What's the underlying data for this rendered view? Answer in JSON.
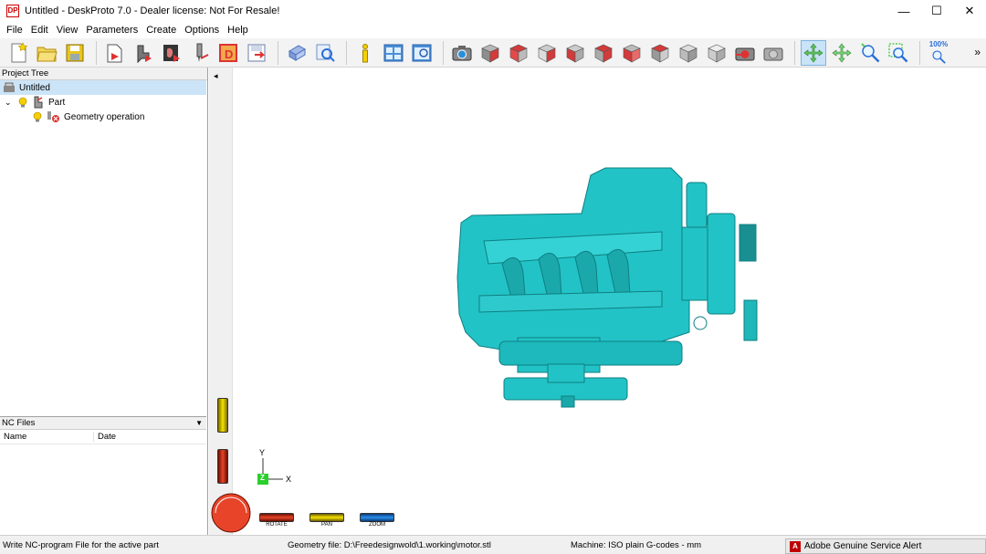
{
  "window": {
    "title": "Untitled - DeskProto 7.0 - Dealer license: Not For Resale!",
    "icon_text": "DP",
    "minimize": "—",
    "maximize": "☐",
    "close": "✕"
  },
  "menu": [
    "File",
    "Edit",
    "View",
    "Parameters",
    "Create",
    "Options",
    "Help"
  ],
  "toolbar": {
    "zoom_label": "100%",
    "overflow": "»"
  },
  "project_tree": {
    "header": "Project Tree",
    "items": [
      {
        "label": "Untitled",
        "level": 0,
        "selected": true
      },
      {
        "label": "Part",
        "level": 1,
        "selected": false
      },
      {
        "label": "Geometry operation",
        "level": 2,
        "selected": false
      }
    ]
  },
  "nc_files": {
    "header": "NC Files",
    "columns": [
      "Name",
      "Date"
    ]
  },
  "viewport": {
    "collapse_arrow": "◂",
    "axis": {
      "y": "Y",
      "z": "Z",
      "x": "X"
    },
    "dials": [
      "ROTATE",
      "PAN",
      "ZOOM"
    ],
    "model_color": "#22c3c6"
  },
  "status": {
    "hint": "Write NC-program File for the active part",
    "geometry": "Geometry file: D:\\Freedesignwold\\1.working\\motor.stl",
    "machine": "Machine: ISO plain G-codes - mm"
  },
  "alert": {
    "icon_text": "A",
    "text": "Adobe Genuine Service Alert"
  }
}
